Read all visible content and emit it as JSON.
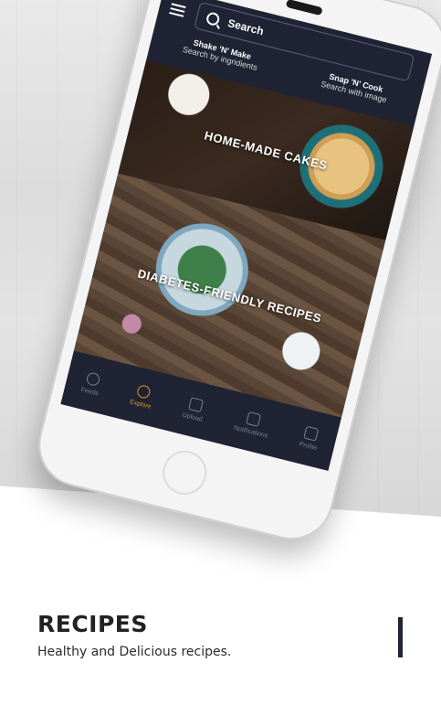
{
  "app": {
    "search_placeholder": "Search",
    "quick_actions": [
      {
        "title": "Shake 'N' Make",
        "subtitle": "Search by ingridients"
      },
      {
        "title": "Snap 'N' Cook",
        "subtitle": "Search with image"
      }
    ],
    "cards": [
      {
        "title": "HOME-MADE CAKES"
      },
      {
        "title": "DIABETES-FRIENDLY RECIPES"
      }
    ],
    "bottom_nav": [
      {
        "label": "Feeds",
        "icon": "bulb-icon",
        "active": false
      },
      {
        "label": "Explore",
        "icon": "search-icon",
        "active": true
      },
      {
        "label": "Upload",
        "icon": "upload-icon",
        "active": false
      },
      {
        "label": "Notifications",
        "icon": "bell-icon",
        "active": false
      },
      {
        "label": "Profile",
        "icon": "profile-icon",
        "active": false
      }
    ],
    "colors": {
      "nav_background": "#1f2333",
      "active_accent": "#d99a2b"
    }
  },
  "promo": {
    "title": "RECIPES",
    "subtitle": "Healthy and Delicious recipes."
  }
}
